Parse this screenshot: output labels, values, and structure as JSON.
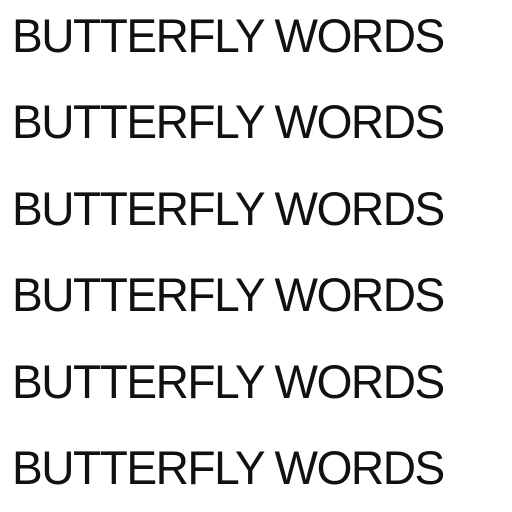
{
  "lines": [
    {
      "text": "BUTTERFLY WORDS"
    },
    {
      "text": "BUTTERFLY WORDS"
    },
    {
      "text": "BUTTERFLY WORDS"
    },
    {
      "text": "BUTTERFLY WORDS"
    },
    {
      "text": "BUTTERFLY WORDS"
    },
    {
      "text": "BUTTERFLY WORDS"
    }
  ],
  "colors": {
    "background": "#ffffff",
    "text": "#111111"
  }
}
